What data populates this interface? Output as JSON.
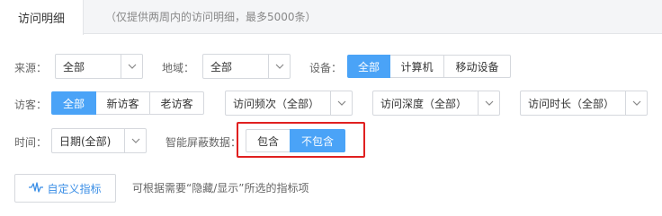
{
  "header": {
    "tab_label": "访问明细",
    "note": "（仅提供两周内的访问明细，最多5000条）"
  },
  "filters": {
    "source": {
      "label": "来源：",
      "value": "全部"
    },
    "region": {
      "label": "地域：",
      "value": "全部"
    },
    "device": {
      "label": "设备：",
      "options": [
        "全部",
        "计算机",
        "移动设备"
      ],
      "selected": "全部"
    },
    "visitor": {
      "label": "访客：",
      "options": [
        "全部",
        "新访客",
        "老访客"
      ],
      "selected": "全部"
    },
    "frequency": {
      "value": "访问频次（全部）"
    },
    "depth": {
      "value": "访问深度（全部）"
    },
    "duration": {
      "value": "访问时长（全部）"
    },
    "time": {
      "label": "时间：",
      "value": "日期(全部)"
    },
    "shield": {
      "label": "智能屏蔽数据：",
      "options": [
        "包含",
        "不包含"
      ],
      "selected": "不包含"
    }
  },
  "custom": {
    "button_label": "自定义指标",
    "hint": "可根据需要“隐藏/显示”所选的指标项"
  },
  "colors": {
    "accent": "#4aa3f7",
    "highlight": "#e02020"
  }
}
